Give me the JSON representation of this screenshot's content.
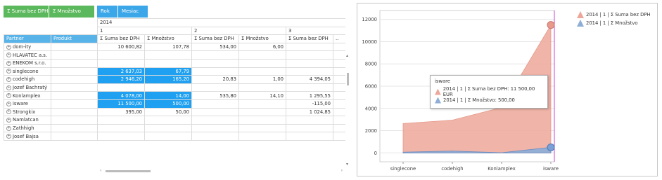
{
  "filters": {
    "data_fields": [
      "Σ Suma bez DPH",
      "Σ Množstvo"
    ],
    "column_fields": [
      "Rok",
      "Mesiac"
    ]
  },
  "grid": {
    "row_headers": [
      "Partner",
      "Produkt"
    ],
    "year": "2014",
    "months": [
      "1",
      "2",
      "3"
    ],
    "measure_headers": [
      "Σ Suma bez DPH",
      "Σ Množstvo",
      "Σ Suma bez DPH",
      "Σ Množstvo",
      "Σ Suma bez DPH",
      ".."
    ],
    "rows": [
      {
        "name": "dom-ity",
        "c": [
          "10 600,82",
          "107,78",
          "534,00",
          "6,00",
          ""
        ],
        "sel": false
      },
      {
        "name": "HLAVATEC a.s.",
        "c": [
          "",
          "",
          "",
          "",
          ""
        ],
        "sel": false
      },
      {
        "name": "ENEKOM s.r.o.",
        "c": [
          "",
          "",
          "",
          "",
          ""
        ],
        "sel": false
      },
      {
        "name": "singlecone",
        "c": [
          "2 637,03",
          "67,79",
          "",
          "",
          ""
        ],
        "sel": true
      },
      {
        "name": "codehigh",
        "c": [
          "2 946,20",
          "165,20",
          "20,83",
          "1,00",
          "4 394,05"
        ],
        "sel": true
      },
      {
        "name": "Jozef Bachratý",
        "c": [
          "",
          "",
          "",
          "",
          ""
        ],
        "sel": false
      },
      {
        "name": "Konlamplex",
        "c": [
          "4 078,00",
          "14,00",
          "535,80",
          "14,10",
          "1 295,55"
        ],
        "sel": true
      },
      {
        "name": "isware",
        "c": [
          "11 500,00",
          "500,00",
          "",
          "",
          "-115,00"
        ],
        "sel": true
      },
      {
        "name": "Strongkix",
        "c": [
          "395,00",
          "50,00",
          "",
          "",
          "1 024,85"
        ],
        "sel": false
      },
      {
        "name": "Namlatcan",
        "c": [
          "",
          "",
          "",
          "",
          ""
        ],
        "sel": false
      },
      {
        "name": "Zathhigh",
        "c": [
          "",
          "",
          "",
          "",
          ""
        ],
        "sel": false
      },
      {
        "name": "Josef Bajsa",
        "c": [
          "",
          "",
          "",
          "",
          ""
        ],
        "sel": false
      }
    ]
  },
  "chart_data": {
    "type": "area",
    "categories": [
      "singlecone",
      "codehigh",
      "Konlamplex",
      "isware"
    ],
    "series": [
      {
        "name": "2014 | 1 | Σ Suma bez DPH",
        "values": [
          2637.03,
          2946.2,
          4078.0,
          11500.0
        ],
        "color": "#eda79a"
      },
      {
        "name": "2014 | 1 | Σ Množstvo",
        "values": [
          67.79,
          165.2,
          14.0,
          500.0
        ],
        "color": "#8eaed6"
      }
    ],
    "ylim": [
      -800,
      12800
    ],
    "yticks": [
      0,
      2000,
      4000,
      6000,
      8000,
      10000,
      12000
    ],
    "grid": true,
    "legend": "top-right"
  },
  "tooltip": {
    "title": "isware",
    "rows": [
      "2014 | 1 | Σ Suma bez DPH: 11 500,00 EUR",
      "2014 | 1 | Σ Množstvo: 500,00"
    ]
  }
}
